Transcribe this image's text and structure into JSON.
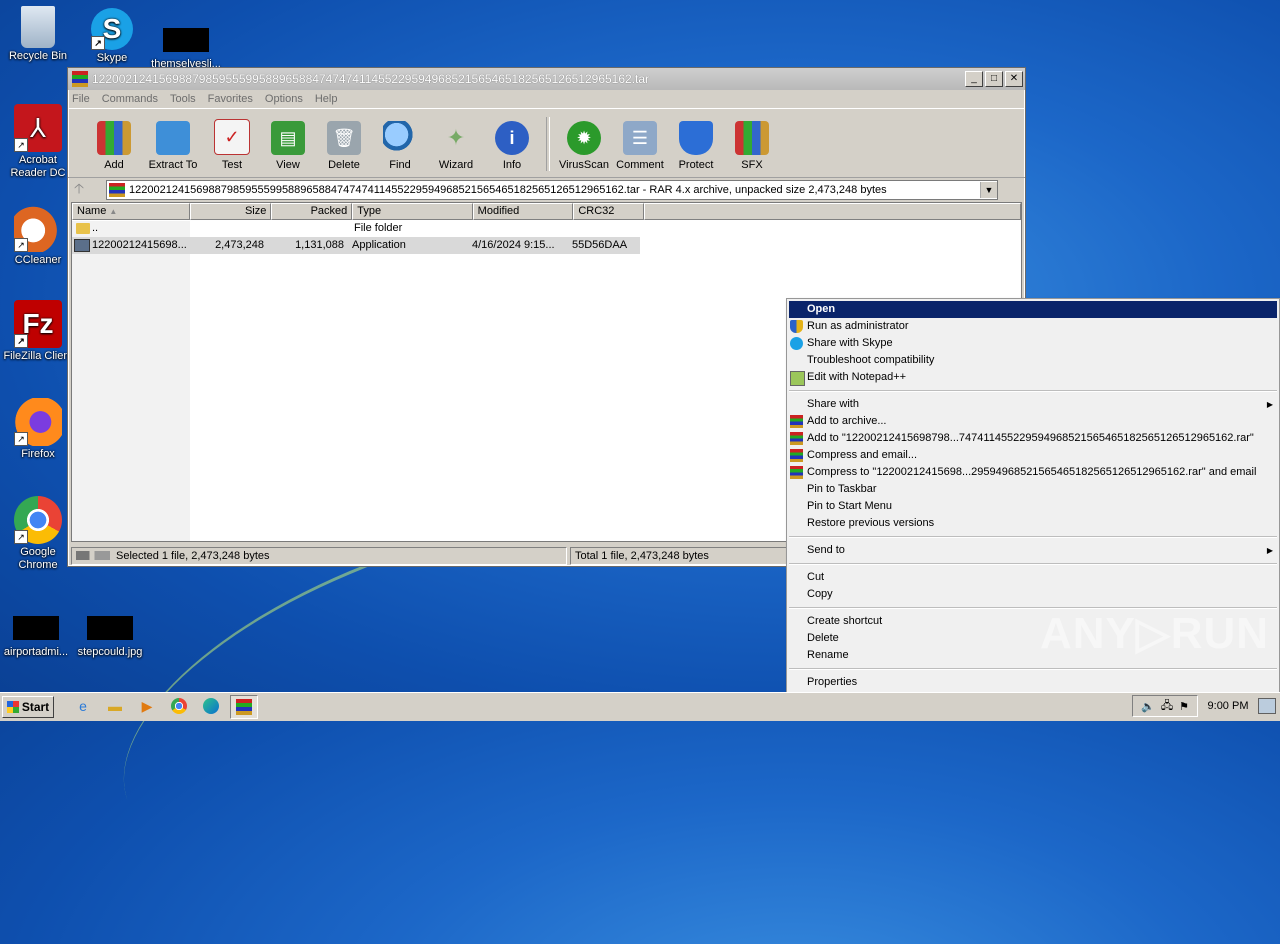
{
  "desktop": {
    "icons": [
      {
        "label": "Recycle Bin"
      },
      {
        "label": "Skype"
      },
      {
        "label": "themselvesli..."
      },
      {
        "label": "Acrobat Reader DC"
      },
      {
        "label": "CCleaner"
      },
      {
        "label": "FileZilla Client"
      },
      {
        "label": "Firefox"
      },
      {
        "label": "Google Chrome"
      },
      {
        "label": "airportadmi..."
      },
      {
        "label": "stepcould.jpg"
      }
    ]
  },
  "window": {
    "title": "12200212415698879859555995889658847474741145522959496852156546518256512651296516​2.tar",
    "menu": [
      "File",
      "Commands",
      "Tools",
      "Favorites",
      "Options",
      "Help"
    ],
    "toolbar": [
      {
        "label": "Add",
        "icon": "add-icon"
      },
      {
        "label": "Extract To",
        "icon": "extract-icon"
      },
      {
        "label": "Test",
        "icon": "test-icon"
      },
      {
        "label": "View",
        "icon": "view-icon"
      },
      {
        "label": "Delete",
        "icon": "delete-icon"
      },
      {
        "label": "Find",
        "icon": "find-icon"
      },
      {
        "label": "Wizard",
        "icon": "wizard-icon"
      },
      {
        "label": "Info",
        "icon": "info-icon"
      },
      {
        "label": "VirusScan",
        "icon": "virusscan-icon"
      },
      {
        "label": "Comment",
        "icon": "comment-icon"
      },
      {
        "label": "Protect",
        "icon": "protect-icon"
      },
      {
        "label": "SFX",
        "icon": "sfx-icon"
      }
    ],
    "address": "122002124156988798595559958896588474747411455229594968521565465182565126512965162.tar - RAR 4.x archive, unpacked size 2,473,248 bytes",
    "columns": [
      "Name",
      "Size",
      "Packed",
      "Type",
      "Modified",
      "CRC32"
    ],
    "rows": [
      {
        "name": "..",
        "size": "",
        "packed": "",
        "type": "File folder",
        "modified": "",
        "crc": ""
      },
      {
        "name": "12200212415698...",
        "size": "2,473,248",
        "packed": "1,131,088",
        "type": "Application",
        "modified": "4/16/2024 9:15...",
        "crc": "55D56DAA"
      }
    ],
    "status_left": "Selected 1 file, 2,473,248 bytes",
    "status_right": "Total 1 file, 2,473,248 bytes"
  },
  "context_menu": {
    "group1": [
      {
        "label": "Open",
        "icon": ""
      },
      {
        "label": "Run as administrator",
        "icon": "shield-icon"
      },
      {
        "label": "Share with Skype",
        "icon": "skype-icon"
      },
      {
        "label": "Troubleshoot compatibility",
        "icon": ""
      },
      {
        "label": "Edit with Notepad++",
        "icon": "notepad-icon"
      }
    ],
    "group2": [
      {
        "label": "Share with",
        "submenu": true
      },
      {
        "label": "Add to archive...",
        "icon": "winrar-icon"
      },
      {
        "label": "Add to \"12200212415698798...74741145522959496852156546518256512651296516​2.rar\"",
        "icon": "winrar-icon"
      },
      {
        "label": "Compress and email...",
        "icon": "winrar-icon"
      },
      {
        "label": "Compress to \"12200212415698...2959496852156546518256512651296516​2.rar\" and email",
        "icon": "winrar-icon"
      },
      {
        "label": "Pin to Taskbar"
      },
      {
        "label": "Pin to Start Menu"
      },
      {
        "label": "Restore previous versions"
      }
    ],
    "group3": [
      {
        "label": "Send to",
        "submenu": true
      }
    ],
    "group4": [
      {
        "label": "Cut"
      },
      {
        "label": "Copy"
      }
    ],
    "group5": [
      {
        "label": "Create shortcut"
      },
      {
        "label": "Delete"
      },
      {
        "label": "Rename"
      }
    ],
    "group6": [
      {
        "label": "Properties"
      }
    ]
  },
  "taskbar": {
    "start_label": "Start",
    "clock": "9:00 PM"
  },
  "watermark": "ANY▷RUN"
}
